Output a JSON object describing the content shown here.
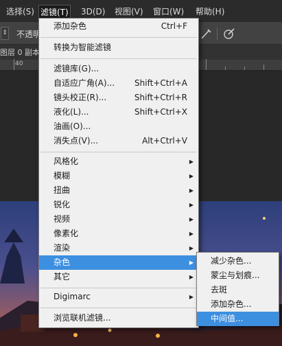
{
  "menubar": {
    "items": [
      {
        "label": "选择(S)"
      },
      {
        "label": "滤镜(T)"
      },
      {
        "label": "3D(D)"
      },
      {
        "label": "视图(V)"
      },
      {
        "label": "窗口(W)"
      },
      {
        "label": "帮助(H)"
      }
    ]
  },
  "options": {
    "opacity_label": "不透明",
    "stepper_glyph": "⇕"
  },
  "doc": {
    "tab_text": "图层 0 副本"
  },
  "ruler": {
    "label": "40"
  },
  "filter_menu": {
    "items": [
      {
        "label": "添加杂色",
        "shortcut": "Ctrl+F"
      },
      {
        "label": "转换为智能滤镜",
        "shortcut": ""
      },
      {
        "label": "滤镜库(G)...",
        "shortcut": ""
      },
      {
        "label": "自适应广角(A)...",
        "shortcut": "Shift+Ctrl+A"
      },
      {
        "label": "镜头校正(R)...",
        "shortcut": "Shift+Ctrl+R"
      },
      {
        "label": "液化(L)...",
        "shortcut": "Shift+Ctrl+X"
      },
      {
        "label": "油画(O)...",
        "shortcut": ""
      },
      {
        "label": "消失点(V)...",
        "shortcut": "Alt+Ctrl+V"
      },
      {
        "label": "风格化",
        "shortcut": ""
      },
      {
        "label": "模糊",
        "shortcut": ""
      },
      {
        "label": "扭曲",
        "shortcut": ""
      },
      {
        "label": "锐化",
        "shortcut": ""
      },
      {
        "label": "视频",
        "shortcut": ""
      },
      {
        "label": "像素化",
        "shortcut": ""
      },
      {
        "label": "渲染",
        "shortcut": ""
      },
      {
        "label": "杂色",
        "shortcut": ""
      },
      {
        "label": "其它",
        "shortcut": ""
      },
      {
        "label": "Digimarc",
        "shortcut": ""
      },
      {
        "label": "浏览联机滤镜...",
        "shortcut": ""
      }
    ],
    "submenu_glyph": "▶"
  },
  "noise_submenu": {
    "items": [
      {
        "label": "减少杂色..."
      },
      {
        "label": "蒙尘与划痕..."
      },
      {
        "label": "去斑"
      },
      {
        "label": "添加杂色..."
      },
      {
        "label": "中间值..."
      }
    ]
  },
  "colors": {
    "highlight": "#3d8fe0",
    "menu_bg": "#f0f0f0",
    "menubar_bg": "#2b2b2b"
  }
}
